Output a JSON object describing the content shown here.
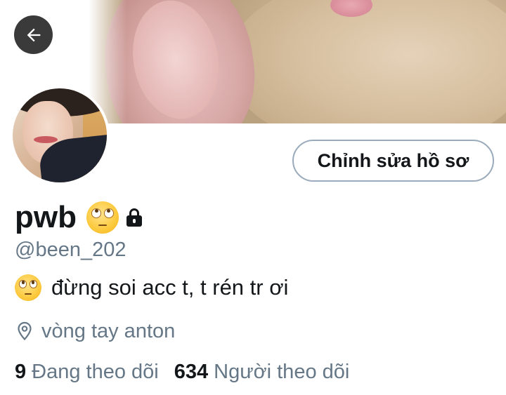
{
  "header": {
    "back_icon": "arrow-left-icon",
    "banner_image": "rabbit-closeup-photo"
  },
  "profile": {
    "avatar_image": "user-avatar-photo",
    "edit_button_label": "Chỉnh sửa hồ sơ",
    "display_name": "pwb",
    "name_emoji": "face-with-rolling-eyes",
    "protected_icon": "lock-icon",
    "handle": "@been_202",
    "bio_emoji": "face-with-rolling-eyes",
    "bio": "đừng soi acc t, t rén tr ơi",
    "location_icon": "location-pin-icon",
    "location": "vòng tay anton",
    "following_count": "9",
    "following_label": "Đang theo dõi",
    "followers_count": "634",
    "followers_label": "Người theo dõi"
  },
  "colors": {
    "text_primary": "#14171a",
    "text_secondary": "#657786",
    "button_border": "#9aabbb",
    "back_button_bg": "#3a3a3a"
  }
}
